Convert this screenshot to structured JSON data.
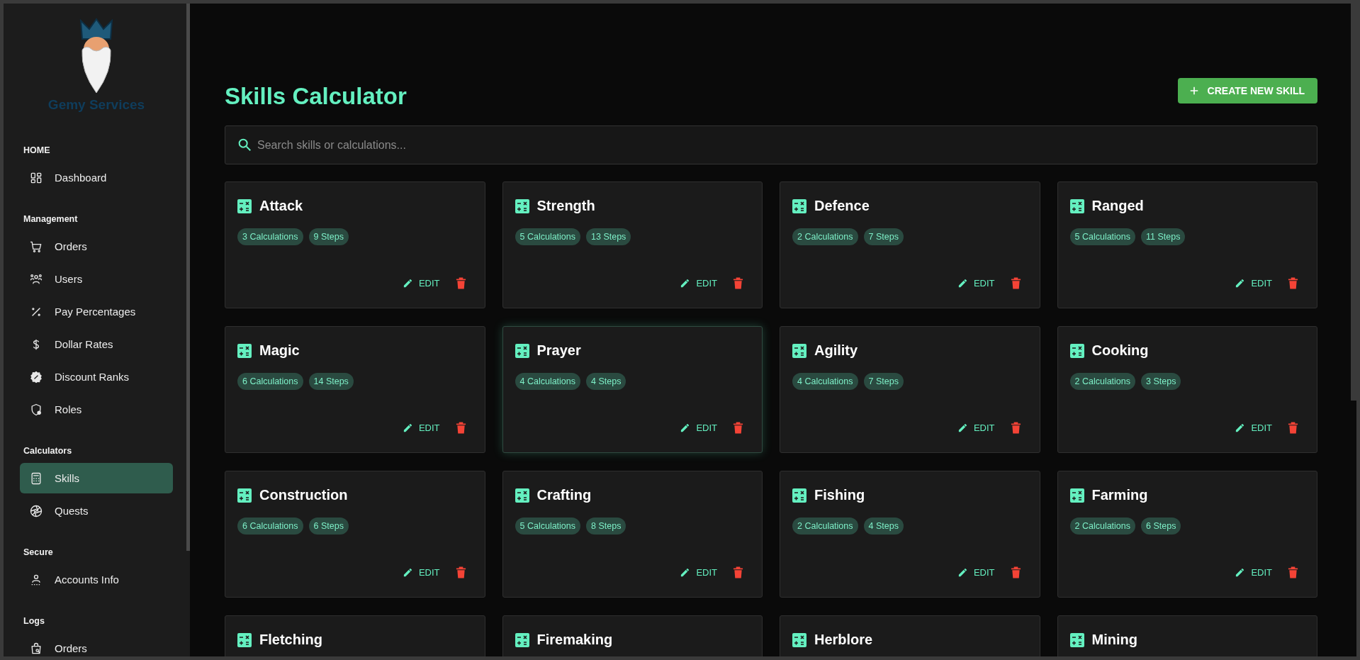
{
  "sidebar": {
    "brand": "Gemy Services",
    "sections": [
      {
        "label": "HOME",
        "items": [
          {
            "label": "Dashboard",
            "selected": false
          }
        ]
      },
      {
        "label": "Management",
        "items": [
          {
            "label": "Orders",
            "selected": false
          },
          {
            "label": "Users",
            "selected": false
          },
          {
            "label": "Pay Percentages",
            "selected": false
          },
          {
            "label": "Dollar Rates",
            "selected": false
          },
          {
            "label": "Discount Ranks",
            "selected": false
          },
          {
            "label": "Roles",
            "selected": false
          }
        ]
      },
      {
        "label": "Calculators",
        "items": [
          {
            "label": "Skills",
            "selected": true
          },
          {
            "label": "Quests",
            "selected": false
          }
        ]
      },
      {
        "label": "Secure",
        "items": [
          {
            "label": "Accounts Info",
            "selected": false
          }
        ]
      },
      {
        "label": "Logs",
        "items": [
          {
            "label": "Orders",
            "selected": false
          }
        ]
      }
    ]
  },
  "page": {
    "title": "Skills Calculator",
    "create_button": "CREATE NEW SKILL",
    "search": {
      "placeholder": "Search skills or calculations..."
    }
  },
  "cards": [
    {
      "title": "Attack",
      "badges": [
        "3 Calculations",
        "9 Steps"
      ],
      "edit": "EDIT",
      "highlighted": false
    },
    {
      "title": "Strength",
      "badges": [
        "5 Calculations",
        "13 Steps"
      ],
      "edit": "EDIT",
      "highlighted": false
    },
    {
      "title": "Defence",
      "badges": [
        "2 Calculations",
        "7 Steps"
      ],
      "edit": "EDIT",
      "highlighted": false
    },
    {
      "title": "Ranged",
      "badges": [
        "5 Calculations",
        "11 Steps"
      ],
      "edit": "EDIT",
      "highlighted": false
    },
    {
      "title": "Magic",
      "badges": [
        "6 Calculations",
        "14 Steps"
      ],
      "edit": "EDIT",
      "highlighted": false
    },
    {
      "title": "Prayer",
      "badges": [
        "4 Calculations",
        "4 Steps"
      ],
      "edit": "EDIT",
      "highlighted": true
    },
    {
      "title": "Agility",
      "badges": [
        "4 Calculations",
        "7 Steps"
      ],
      "edit": "EDIT",
      "highlighted": false
    },
    {
      "title": "Cooking",
      "badges": [
        "2 Calculations",
        "3 Steps"
      ],
      "edit": "EDIT",
      "highlighted": false
    },
    {
      "title": "Construction",
      "badges": [
        "6 Calculations",
        "6 Steps"
      ],
      "edit": "EDIT",
      "highlighted": false
    },
    {
      "title": "Crafting",
      "badges": [
        "5 Calculations",
        "8 Steps"
      ],
      "edit": "EDIT",
      "highlighted": false
    },
    {
      "title": "Fishing",
      "badges": [
        "2 Calculations",
        "4 Steps"
      ],
      "edit": "EDIT",
      "highlighted": false
    },
    {
      "title": "Farming",
      "badges": [
        "2 Calculations",
        "6 Steps"
      ],
      "edit": "EDIT",
      "highlighted": false
    },
    {
      "title": "Fletching",
      "highlighted": false
    },
    {
      "title": "Firemaking",
      "highlighted": false
    },
    {
      "title": "Herblore",
      "highlighted": false
    },
    {
      "title": "Mining",
      "highlighted": false
    }
  ]
}
